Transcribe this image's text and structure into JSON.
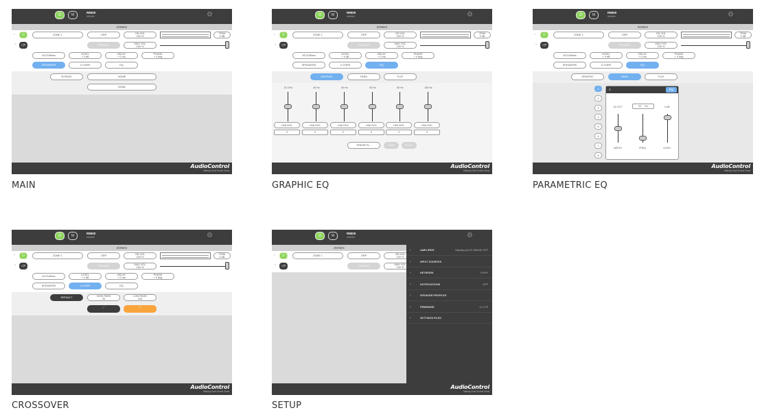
{
  "captions": {
    "main": "MAIN",
    "graphic": "GRAPHIC EQ",
    "parametric": "PARAMETRIC EQ",
    "crossover": "CROSSOVER",
    "setup": "SETUP"
  },
  "common": {
    "device_name": "R8500",
    "device_sub": "######",
    "zones_title": "ZONES",
    "zone_name": "ZONE 1",
    "source": "GRP",
    "on_vol": "ON VOL\n100 %",
    "max_vol": "MAX VOL\n100 %",
    "trim": "TRIM\n0 dB",
    "rename": "RENAME",
    "acc": "ACCUBass",
    "level": "LEVEL\n+ 0 dB",
    "delay": "DELAY\n+ 0 ms",
    "phase": "PHASE\n+ 0 deg",
    "tab_speakers": "SPEAKERS",
    "tab_xover": "X-OVER",
    "tab_eq": "EQ",
    "logo": "AudioControl",
    "tagline": "Making Good Sound Great",
    "power_glyph": "⏻",
    "mute_glyph": "M"
  },
  "main": {
    "bypass": "BYPASS",
    "home": "HOME",
    "none": "NONE"
  },
  "graphic": {
    "mode_graphic": "GRAPHIC",
    "mode_para": "PARA",
    "mode_flat": "FLAT",
    "bands": [
      {
        "freq": "31.5 Hz",
        "unlock": "UNLOCK",
        "value": "0",
        "level": 0.5
      },
      {
        "freq": "40 Hz",
        "unlock": "UNLOCK",
        "value": "0",
        "level": 0.5
      },
      {
        "freq": "50 Hz",
        "unlock": "UNLOCK",
        "value": "0",
        "level": 0.5
      },
      {
        "freq": "63 Hz",
        "unlock": "UNLOCK",
        "value": "0",
        "level": 0.5
      },
      {
        "freq": "80 Hz",
        "unlock": "UNLOCK",
        "value": "0",
        "level": 0.5
      },
      {
        "freq": "100 Hz",
        "unlock": "UNLOCK",
        "value": "0",
        "level": 0.5
      }
    ],
    "presets": "PRESETS...",
    "save": "SAVE",
    "reset": "RESET"
  },
  "parametric": {
    "mode_graphic": "GRAPHIC",
    "mode_para": "PARA",
    "mode_flat": "FLAT",
    "band_numbers": [
      "1",
      "2",
      "3",
      "4",
      "5",
      "6",
      "7",
      "8"
    ],
    "selected_band": "1",
    "eq_badge": "EQ",
    "width_value": "1/2 OCT",
    "freq_value": "20",
    "freq_unit": "Hz",
    "level_value": "0 dB",
    "width_label": "WIDTH",
    "freq_label": "FREQ",
    "level_label": "LEVEL"
  },
  "crossover": {
    "default": "DEFAULT",
    "high_pass": "HIGH PASS\n20",
    "low_pass": "LOW PASS\n100"
  },
  "setup": {
    "items": [
      {
        "label": "AMPLIFIER",
        "value": "Standby   AUTO   SENSE OFF"
      },
      {
        "label": "INPUT SOURCES",
        "value": ""
      },
      {
        "label": "NETWORK",
        "value": "DHCP"
      },
      {
        "label": "NOTIFICATIONS",
        "value": "OFF"
      },
      {
        "label": "SPEAKER PROFILES",
        "value": ""
      },
      {
        "label": "FIRMWARE",
        "value": "v1.0.79"
      },
      {
        "label": "SETTINGS FILES",
        "value": ""
      }
    ]
  },
  "colors": {
    "dark": "#3d3d3d",
    "green": "#8bd35b",
    "blue": "#72b0ef",
    "orange": "#f9a43c"
  }
}
